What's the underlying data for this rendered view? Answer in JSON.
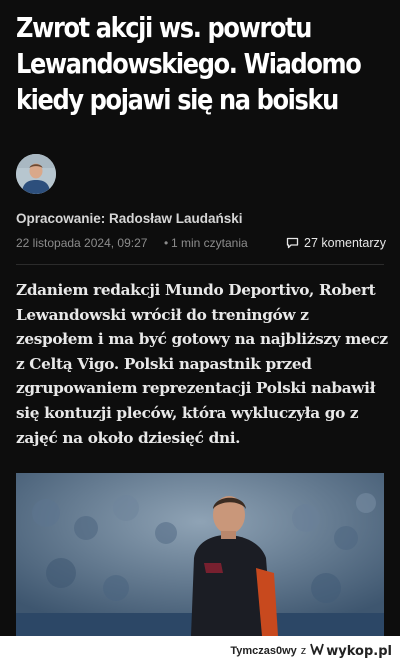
{
  "article": {
    "title": "Zwrot akcji ws. powrotu Lewandowskiego. Wiadomo kiedy pojawi się na boisku",
    "author_line": "Opracowanie: Radosław Laudański",
    "date": "22 listopada 2024, 09:27",
    "separator": "•",
    "read_time": "1 min czytania",
    "comments": "27 komentarzy",
    "lead": "Zdaniem redakcji Mundo Deportivo, Robert Lewandowski wrócił do treningów z zespołem i ma być gotowy na najbliższy mecz z Celtą Vigo. Polski napastnik przed zgrupowaniem reprezentacji Polski nabawił się kontuzji pleców, która wykluczyła go z zajęć na około dziesięć dni."
  },
  "footer": {
    "user": "Tymczas0wy",
    "connector": "z",
    "site": "wykop.pl"
  },
  "colors": {
    "background": "#0d0d0d",
    "text": "#ffffff",
    "muted": "#8c8c8c"
  },
  "icons": {
    "comments": "speech-bubble-icon",
    "site_logo": "wykop-logo-icon"
  }
}
